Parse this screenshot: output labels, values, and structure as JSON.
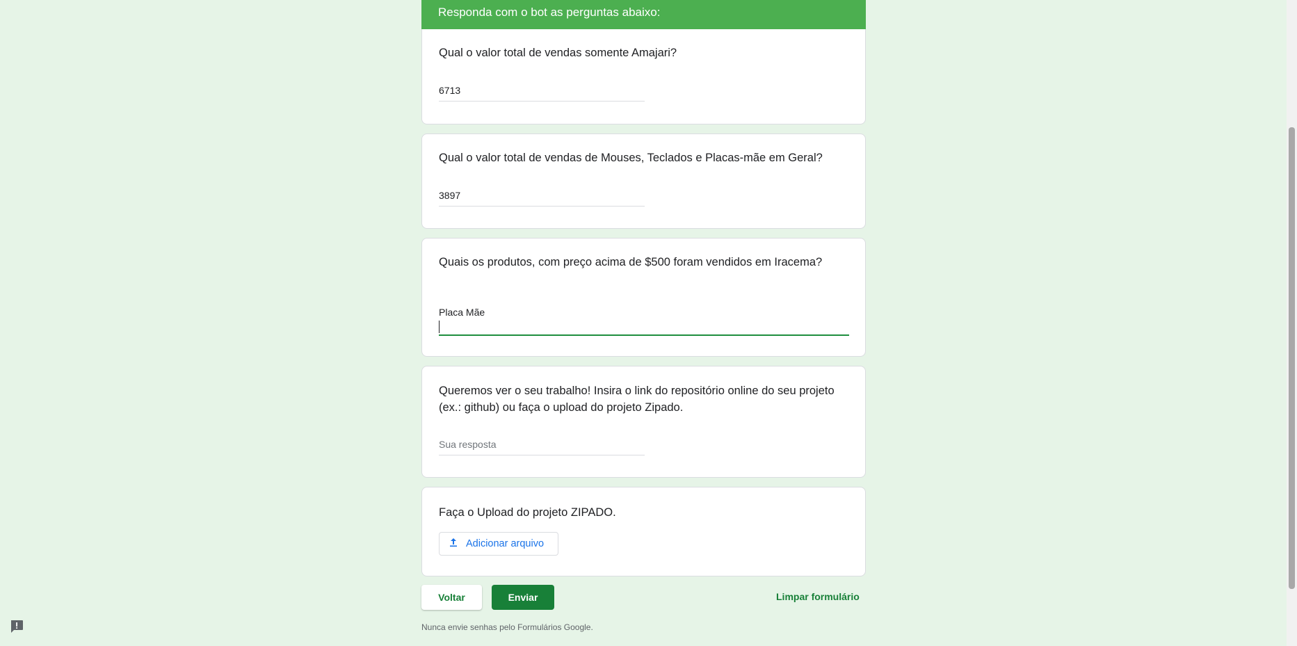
{
  "section": {
    "title": "Responda com o bot as perguntas abaixo:"
  },
  "questions": [
    {
      "title": "Qual o valor total de vendas somente Amajari?",
      "answer": "6713"
    },
    {
      "title": "Qual o valor total de vendas de Mouses, Teclados e Placas-mãe em Geral?",
      "answer": "3897"
    },
    {
      "title": "Quais os produtos, com preço acima de $500 foram vendidos em Iracema?",
      "answer": "Placa Mãe"
    },
    {
      "title": "Queremos ver o seu trabalho! Insira o link do repositório online do seu projeto (ex.: github) ou faça o upload do projeto Zipado.",
      "placeholder": "Sua resposta"
    },
    {
      "title": "Faça o Upload do projeto ZIPADO.",
      "button_label": "Adicionar arquivo"
    }
  ],
  "actions": {
    "back": "Voltar",
    "submit": "Enviar",
    "clear": "Limpar formulário"
  },
  "footer": {
    "note": "Nunca envie senhas pelo Formulários Google."
  },
  "icons": {
    "upload": "upload-icon",
    "feedback": "report-feedback-icon"
  },
  "colors": {
    "accent": "#4caf50",
    "primary": "#188038",
    "background": "#e6f4e7",
    "link": "#1a73e8"
  }
}
